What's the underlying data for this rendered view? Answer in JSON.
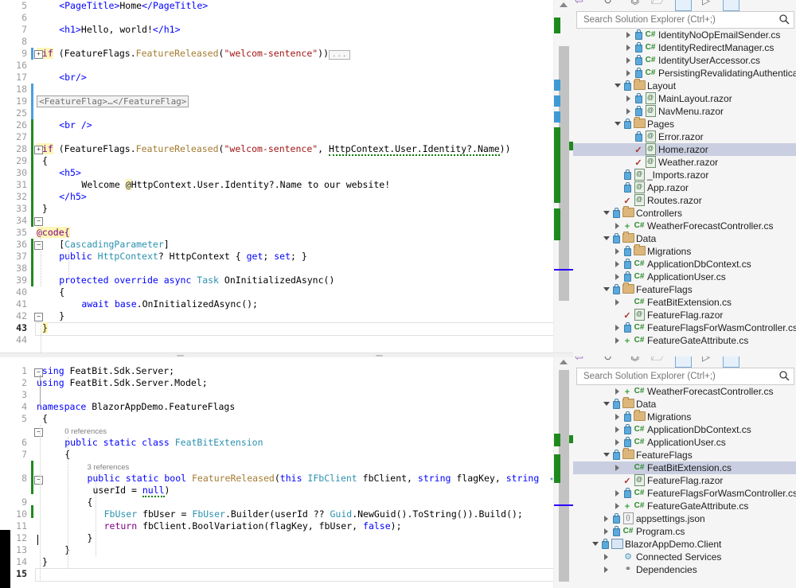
{
  "window": {
    "app": "Visual Studio",
    "theme_bg": "#ffffff",
    "accent": "#2a00ff"
  },
  "editor_top": {
    "name": "Home.razor",
    "cursor_line": 43,
    "lines": [
      {
        "n": "5",
        "indent": 4,
        "segments": [
          {
            "t": "<",
            "c": "tag"
          },
          {
            "t": "PageTitle",
            "c": "tag"
          },
          {
            "t": ">",
            "c": "tag"
          },
          {
            "t": "Home",
            "c": "plain"
          },
          {
            "t": "</",
            "c": "tag"
          },
          {
            "t": "PageTitle",
            "c": "tag"
          },
          {
            "t": ">",
            "c": "tag"
          }
        ]
      },
      {
        "n": "6",
        "indent": 0,
        "segments": []
      },
      {
        "n": "7",
        "indent": 4,
        "segments": [
          {
            "t": "<h1>",
            "c": "tag"
          },
          {
            "t": "Hello, world!",
            "c": "plain"
          },
          {
            "t": "</h1>",
            "c": "tag"
          }
        ]
      },
      {
        "n": "8",
        "indent": 0,
        "segments": []
      },
      {
        "n": "9",
        "indent": 0,
        "segments": [
          {
            "t": "@if",
            "c": "razor-hl"
          },
          {
            "t": " (",
            "c": "plain"
          },
          {
            "t": "FeatureFlags",
            "c": "plain"
          },
          {
            "t": ".",
            "c": "plain"
          },
          {
            "t": "FeatureReleased",
            "c": "meth"
          },
          {
            "t": "(",
            "c": "plain"
          },
          {
            "t": "\"welcom-sentence\"",
            "c": "s"
          },
          {
            "t": "))",
            "c": "plain"
          }
        ],
        "trailing_ellipsis": true
      },
      {
        "n": "16",
        "indent": 0,
        "segments": []
      },
      {
        "n": "17",
        "indent": 4,
        "segments": [
          {
            "t": "<br/>",
            "c": "tag"
          }
        ]
      },
      {
        "n": "18",
        "indent": 0,
        "segments": []
      },
      {
        "n": "19",
        "indent": 0,
        "collapsed_text": "<FeatureFlag>…</FeatureFlag>"
      },
      {
        "n": "25",
        "indent": 0,
        "segments": []
      },
      {
        "n": "26",
        "indent": 4,
        "segments": [
          {
            "t": "<br />",
            "c": "tag"
          }
        ]
      },
      {
        "n": "27",
        "indent": 0,
        "segments": []
      },
      {
        "n": "28",
        "indent": 0,
        "segments": [
          {
            "t": "@if",
            "c": "razor-hl"
          },
          {
            "t": " (",
            "c": "plain"
          },
          {
            "t": "FeatureFlags",
            "c": "plain"
          },
          {
            "t": ".",
            "c": "plain"
          },
          {
            "t": "FeatureReleased",
            "c": "meth"
          },
          {
            "t": "(",
            "c": "plain"
          },
          {
            "t": "\"welcom-sentence\"",
            "c": "s"
          },
          {
            "t": ", ",
            "c": "plain"
          },
          {
            "t": "HttpContext.User.Identity?.Name",
            "c": "squiggle"
          },
          {
            "t": "))",
            "c": "plain"
          }
        ]
      },
      {
        "n": "29",
        "indent": 1,
        "segments": [
          {
            "t": "{",
            "c": "plain"
          }
        ]
      },
      {
        "n": "30",
        "indent": 4,
        "segments": [
          {
            "t": "<h5>",
            "c": "tag"
          }
        ]
      },
      {
        "n": "31",
        "indent": 8,
        "segments": [
          {
            "t": "Welcome ",
            "c": "plain"
          },
          {
            "t": "@",
            "c": "hl"
          },
          {
            "t": "HttpContext.User.Identity?.Name",
            "c": "plain"
          },
          {
            "t": " to our website!",
            "c": "plain"
          }
        ]
      },
      {
        "n": "32",
        "indent": 4,
        "segments": [
          {
            "t": "</h5>",
            "c": "tag"
          }
        ]
      },
      {
        "n": "33",
        "indent": 1,
        "segments": [
          {
            "t": "}",
            "c": "plain"
          }
        ]
      },
      {
        "n": "34",
        "indent": 0,
        "segments": []
      },
      {
        "n": "35",
        "indent": 0,
        "segments": [
          {
            "t": "@code{",
            "c": "razor-hl"
          }
        ]
      },
      {
        "n": "36",
        "indent": 4,
        "segments": [
          {
            "t": "[",
            "c": "plain"
          },
          {
            "t": "CascadingParameter",
            "c": "t"
          },
          {
            "t": "]",
            "c": "plain"
          }
        ]
      },
      {
        "n": "37",
        "indent": 4,
        "segments": [
          {
            "t": "public ",
            "c": "k"
          },
          {
            "t": "HttpContext",
            "c": "t"
          },
          {
            "t": "? HttpContext { ",
            "c": "plain"
          },
          {
            "t": "get",
            "c": "k"
          },
          {
            "t": "; ",
            "c": "plain"
          },
          {
            "t": "set",
            "c": "k"
          },
          {
            "t": "; }",
            "c": "plain"
          }
        ]
      },
      {
        "n": "38",
        "indent": 0,
        "segments": []
      },
      {
        "n": "39",
        "indent": 4,
        "segments": [
          {
            "t": "protected override async ",
            "c": "k"
          },
          {
            "t": "Task",
            "c": "t"
          },
          {
            "t": " OnInitializedAsync()",
            "c": "plain"
          }
        ]
      },
      {
        "n": "40",
        "indent": 4,
        "segments": [
          {
            "t": "{",
            "c": "plain"
          }
        ]
      },
      {
        "n": "41",
        "indent": 8,
        "segments": [
          {
            "t": "await ",
            "c": "k"
          },
          {
            "t": "base",
            "c": "k"
          },
          {
            "t": ".OnInitializedAsync();",
            "c": "plain"
          }
        ]
      },
      {
        "n": "42",
        "indent": 4,
        "segments": [
          {
            "t": "}",
            "c": "plain"
          }
        ]
      },
      {
        "n": "43",
        "indent": 1,
        "segments": [
          {
            "t": "}",
            "c": "hl"
          }
        ],
        "current": true
      },
      {
        "n": "44",
        "indent": 0,
        "segments": []
      }
    ]
  },
  "editor_bottom": {
    "name": "FeatBitExtension.cs",
    "cursor_line": 15,
    "lines": [
      {
        "n": "1",
        "indent": 0,
        "segments": [
          {
            "t": "using ",
            "c": "k"
          },
          {
            "t": "FeatBit.Sdk.Server;",
            "c": "plain"
          }
        ]
      },
      {
        "n": "2",
        "indent": 0,
        "segments": [
          {
            "t": "using ",
            "c": "k"
          },
          {
            "t": "FeatBit.Sdk.Server.Model;",
            "c": "plain"
          }
        ]
      },
      {
        "n": "3",
        "indent": 0,
        "segments": []
      },
      {
        "n": "4",
        "indent": 0,
        "segments": [
          {
            "t": "namespace ",
            "c": "k"
          },
          {
            "t": "BlazorAppDemo.FeatureFlags",
            "c": "plain"
          }
        ]
      },
      {
        "n": "5",
        "indent": 1,
        "segments": [
          {
            "t": "{",
            "c": "plain"
          }
        ]
      },
      {
        "n": "",
        "indent": 5,
        "reference_text": "0 references"
      },
      {
        "n": "6",
        "indent": 5,
        "segments": [
          {
            "t": "public static class ",
            "c": "k"
          },
          {
            "t": "FeatBitExtension",
            "c": "t"
          }
        ]
      },
      {
        "n": "7",
        "indent": 5,
        "segments": [
          {
            "t": "{",
            "c": "plain"
          }
        ]
      },
      {
        "n": "",
        "indent": 9,
        "reference_text": "3 references"
      },
      {
        "n": "8",
        "indent": 9,
        "segments": [
          {
            "t": "public static bool ",
            "c": "k"
          },
          {
            "t": "FeatureReleased",
            "c": "meth"
          },
          {
            "t": "(",
            "c": "plain"
          },
          {
            "t": "this ",
            "c": "k"
          },
          {
            "t": "IFbClient",
            "c": "t"
          },
          {
            "t": " fbClient, ",
            "c": "plain"
          },
          {
            "t": "string",
            "c": "k"
          },
          {
            "t": " flagKey, ",
            "c": "plain"
          },
          {
            "t": "string",
            "c": "k"
          }
        ],
        "wrap_glyph": true
      },
      {
        "n": "",
        "indent": 10,
        "segments": [
          {
            "t": "userId = ",
            "c": "plain"
          },
          {
            "t": "null",
            "c": "k-sq"
          },
          {
            "t": ")",
            "c": "plain"
          }
        ]
      },
      {
        "n": "9",
        "indent": 9,
        "segments": [
          {
            "t": "{",
            "c": "plain"
          }
        ]
      },
      {
        "n": "10",
        "indent": 12,
        "segments": [
          {
            "t": "FbUser",
            "c": "t"
          },
          {
            "t": " fbUser = ",
            "c": "plain"
          },
          {
            "t": "FbUser",
            "c": "t"
          },
          {
            "t": ".Builder(userId ?? ",
            "c": "plain"
          },
          {
            "t": "Guid",
            "c": "t"
          },
          {
            "t": ".NewGuid().ToString()).Build();",
            "c": "plain"
          }
        ]
      },
      {
        "n": "11",
        "indent": 12,
        "segments": [
          {
            "t": "return ",
            "c": "razor"
          },
          {
            "t": "fbClient.BoolVariation(flagKey, fbUser, ",
            "c": "plain"
          },
          {
            "t": "false",
            "c": "k"
          },
          {
            "t": ");",
            "c": "plain"
          }
        ]
      },
      {
        "n": "12",
        "indent": 9,
        "segments": [
          {
            "t": "}",
            "c": "plain"
          }
        ]
      },
      {
        "n": "13",
        "indent": 5,
        "segments": [
          {
            "t": "}",
            "c": "plain"
          }
        ]
      },
      {
        "n": "14",
        "indent": 1,
        "segments": [
          {
            "t": "}",
            "c": "plain"
          }
        ]
      },
      {
        "n": "15",
        "indent": 0,
        "segments": [],
        "current": true
      }
    ]
  },
  "solution_explorer_top": {
    "search_placeholder": "Search Solution Explorer (Ctrl+;)",
    "search_value": "",
    "search_icon": "magnifier-icon",
    "items": [
      {
        "depth": 4,
        "expander": "right",
        "lock": true,
        "icon": "cs",
        "label": "IdentityNoOpEmailSender.cs"
      },
      {
        "depth": 4,
        "expander": "right",
        "lock": true,
        "icon": "cs",
        "label": "IdentityRedirectManager.cs"
      },
      {
        "depth": 4,
        "expander": "right",
        "lock": true,
        "icon": "cs",
        "label": "IdentityUserAccessor.cs"
      },
      {
        "depth": 4,
        "expander": "right",
        "lock": true,
        "icon": "cs",
        "label": "PersistingRevalidatingAuthenticatic"
      },
      {
        "depth": 3,
        "expander": "down",
        "lock": true,
        "icon": "folder",
        "label": "Layout"
      },
      {
        "depth": 4,
        "expander": "right",
        "lock": true,
        "icon": "razor",
        "label": "MainLayout.razor"
      },
      {
        "depth": 4,
        "expander": "right",
        "lock": true,
        "icon": "razor",
        "label": "NavMenu.razor"
      },
      {
        "depth": 3,
        "expander": "down",
        "lock": true,
        "icon": "folder",
        "label": "Pages"
      },
      {
        "depth": 4,
        "expander": "none",
        "lock": true,
        "icon": "razor",
        "label": "Error.razor"
      },
      {
        "depth": 4,
        "expander": "none",
        "lock": false,
        "icon": "razor",
        "label": "Home.razor",
        "check": true,
        "selected": true
      },
      {
        "depth": 4,
        "expander": "none",
        "lock": false,
        "icon": "razor",
        "label": "Weather.razor",
        "check": true
      },
      {
        "depth": 3,
        "expander": "none",
        "lock": true,
        "icon": "razor",
        "label": "_Imports.razor"
      },
      {
        "depth": 3,
        "expander": "none",
        "lock": true,
        "icon": "razor",
        "label": "App.razor"
      },
      {
        "depth": 3,
        "expander": "none",
        "lock": false,
        "icon": "razor",
        "label": "Routes.razor",
        "check": true
      },
      {
        "depth": 2,
        "expander": "down",
        "lock": true,
        "icon": "folder",
        "label": "Controllers"
      },
      {
        "depth": 3,
        "expander": "right",
        "lock": false,
        "icon": "cs",
        "label": "WeatherForecastController.cs",
        "plus": true
      },
      {
        "depth": 2,
        "expander": "down",
        "lock": true,
        "icon": "folder",
        "label": "Data"
      },
      {
        "depth": 3,
        "expander": "right",
        "lock": true,
        "icon": "folder",
        "label": "Migrations"
      },
      {
        "depth": 3,
        "expander": "right",
        "lock": true,
        "icon": "cs",
        "label": "ApplicationDbContext.cs"
      },
      {
        "depth": 3,
        "expander": "right",
        "lock": true,
        "icon": "cs",
        "label": "ApplicationUser.cs"
      },
      {
        "depth": 2,
        "expander": "down",
        "lock": true,
        "icon": "folder",
        "label": "FeatureFlags"
      },
      {
        "depth": 3,
        "expander": "right",
        "lock": false,
        "icon": "cs",
        "label": "FeatBitExtension.cs"
      },
      {
        "depth": 3,
        "expander": "none",
        "lock": false,
        "icon": "razor",
        "label": "FeatureFlag.razor",
        "check": true
      },
      {
        "depth": 3,
        "expander": "right",
        "lock": true,
        "icon": "cs",
        "label": "FeatureFlagsForWasmController.cs"
      },
      {
        "depth": 3,
        "expander": "right",
        "lock": false,
        "icon": "cs",
        "label": "FeatureGateAttribute.cs",
        "plus": true,
        "clipped": true
      }
    ]
  },
  "solution_explorer_bottom": {
    "search_placeholder": "Search Solution Explorer (Ctrl+;)",
    "search_value": "",
    "search_icon": "magnifier-icon",
    "items": [
      {
        "depth": 3,
        "expander": "right",
        "lock": false,
        "icon": "cs",
        "label": "WeatherForecastController.cs",
        "plus": true
      },
      {
        "depth": 2,
        "expander": "down",
        "lock": true,
        "icon": "folder",
        "label": "Data"
      },
      {
        "depth": 3,
        "expander": "right",
        "lock": true,
        "icon": "folder",
        "label": "Migrations"
      },
      {
        "depth": 3,
        "expander": "right",
        "lock": true,
        "icon": "cs",
        "label": "ApplicationDbContext.cs"
      },
      {
        "depth": 3,
        "expander": "right",
        "lock": true,
        "icon": "cs",
        "label": "ApplicationUser.cs"
      },
      {
        "depth": 2,
        "expander": "down",
        "lock": true,
        "icon": "folder",
        "label": "FeatureFlags"
      },
      {
        "depth": 3,
        "expander": "right",
        "lock": false,
        "icon": "cs",
        "label": "FeatBitExtension.cs",
        "selected": true
      },
      {
        "depth": 3,
        "expander": "none",
        "lock": false,
        "icon": "razor",
        "label": "FeatureFlag.razor",
        "check": true
      },
      {
        "depth": 3,
        "expander": "right",
        "lock": true,
        "icon": "cs",
        "label": "FeatureFlagsForWasmController.cs"
      },
      {
        "depth": 3,
        "expander": "right",
        "lock": false,
        "icon": "cs",
        "label": "FeatureGateAttribute.cs",
        "plus": true
      },
      {
        "depth": 2,
        "expander": "right",
        "lock": true,
        "icon": "json",
        "label": "appsettings.json"
      },
      {
        "depth": 2,
        "expander": "right",
        "lock": true,
        "icon": "cs",
        "label": "Program.cs"
      },
      {
        "depth": 1,
        "expander": "down",
        "lock": true,
        "icon": "project",
        "label": "BlazorAppDemo.Client"
      },
      {
        "depth": 2,
        "expander": "right",
        "lock": false,
        "icon": "service",
        "label": "Connected Services"
      },
      {
        "depth": 2,
        "expander": "right",
        "lock": false,
        "icon": "deps",
        "label": "Dependencies"
      }
    ]
  }
}
